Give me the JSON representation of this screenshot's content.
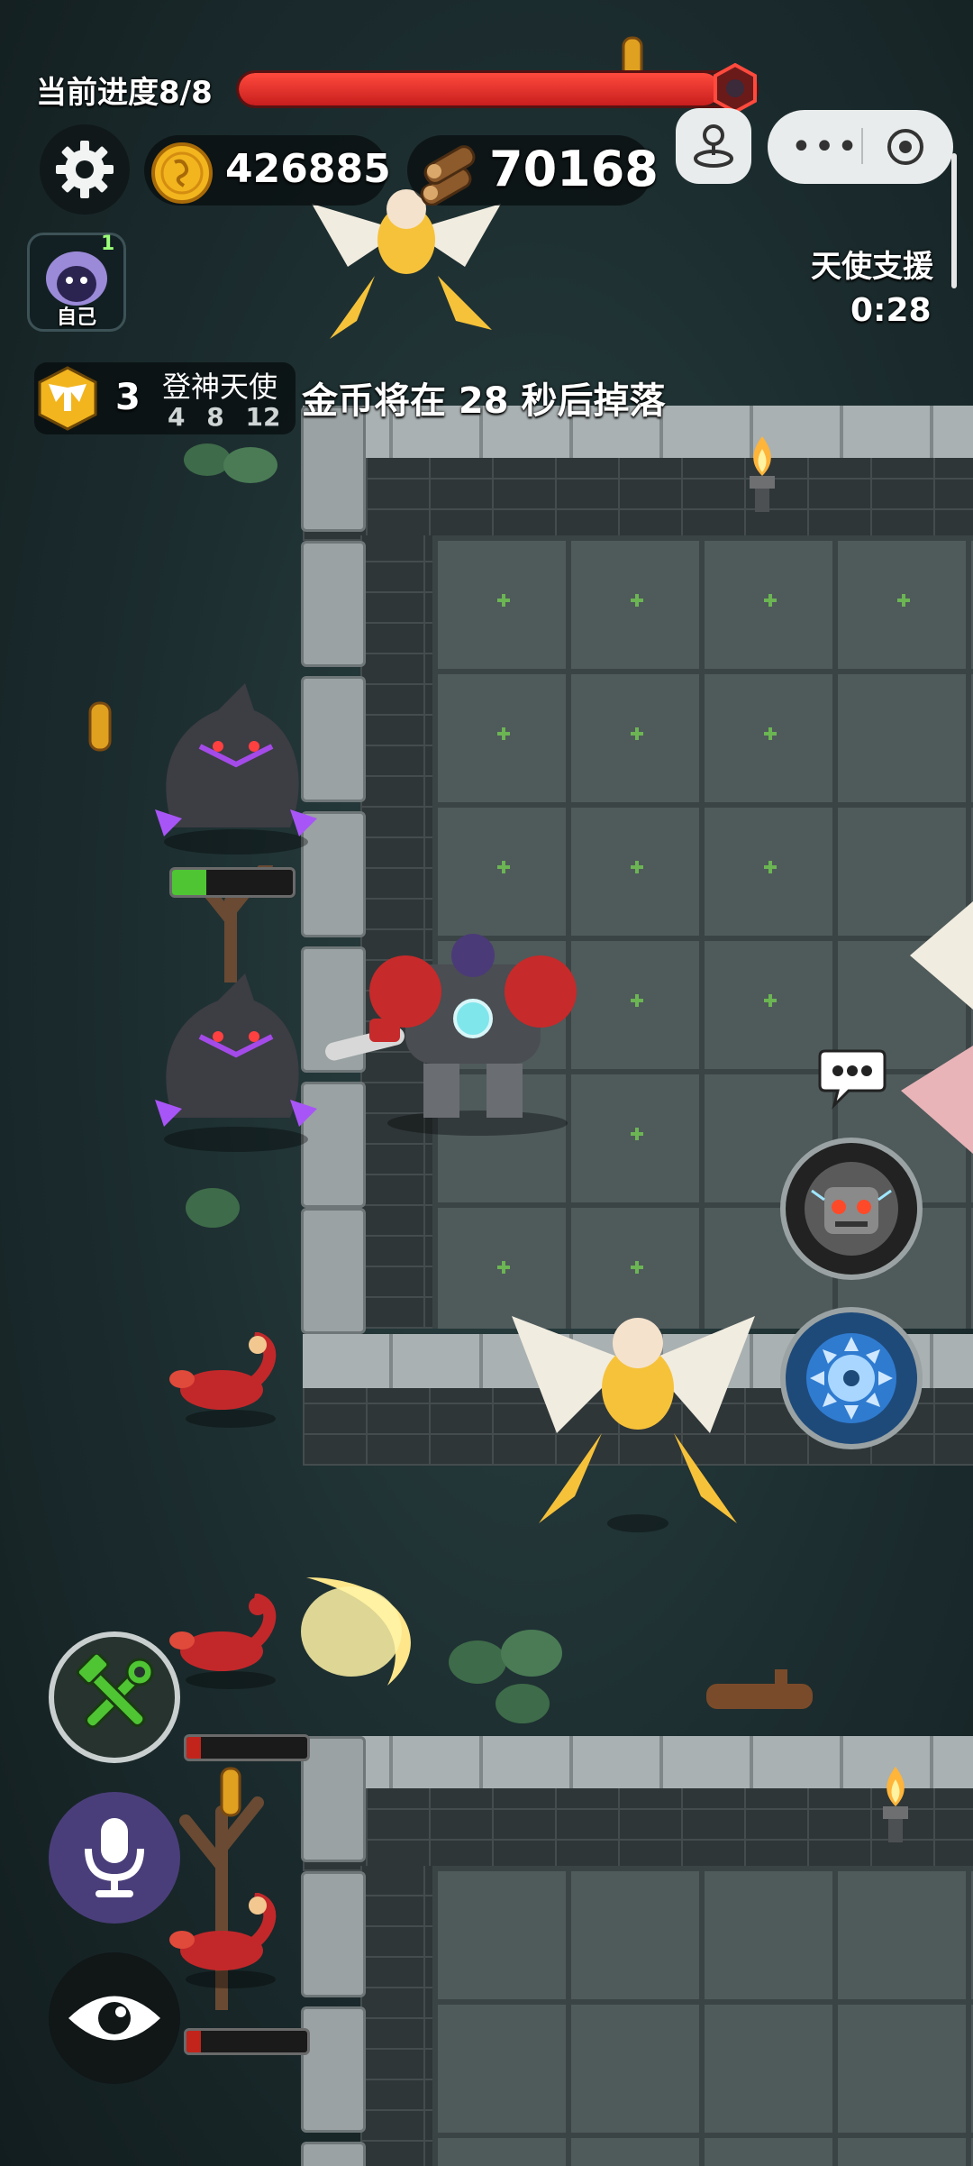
{
  "hud": {
    "progress_label": "当前进度8/8",
    "progress_fraction": 0.93,
    "coins": "426885",
    "wood": "70168",
    "self_label": "自己",
    "self_count": "1",
    "angel_support_title": "天使支援",
    "angel_support_timer": "0:28",
    "buff_level": "3",
    "buff_name": "登神天使",
    "buff_tiers": "4 8 12",
    "drop_notice": "金币将在 28 秒后掉落"
  },
  "enemies": {
    "wolf_top_hp_fraction": 0.28,
    "scorpion_mid_hp_fraction": 0.12,
    "scorpion_low_hp_fraction": 0.12
  },
  "colors": {
    "accent_red": "#d62a22",
    "hp_green": "#4fc534",
    "hp_red": "#c2241c",
    "gold": "#f2b51e",
    "angel_gold": "#f6c23a",
    "mech_red": "#c72a2a"
  },
  "icons": {
    "settings": "gear-icon",
    "coin": "coin-icon",
    "wood": "wood-logs-icon",
    "joystick": "joystick-icon",
    "more": "more-dots-icon",
    "close": "target-close-icon",
    "build": "wrench-hammer-icon",
    "voice": "microphone-icon",
    "view": "eye-icon",
    "chat": "chat-bubble-icon",
    "robot_skill": "robot-head-icon",
    "saw_skill": "saw-blade-icon"
  }
}
